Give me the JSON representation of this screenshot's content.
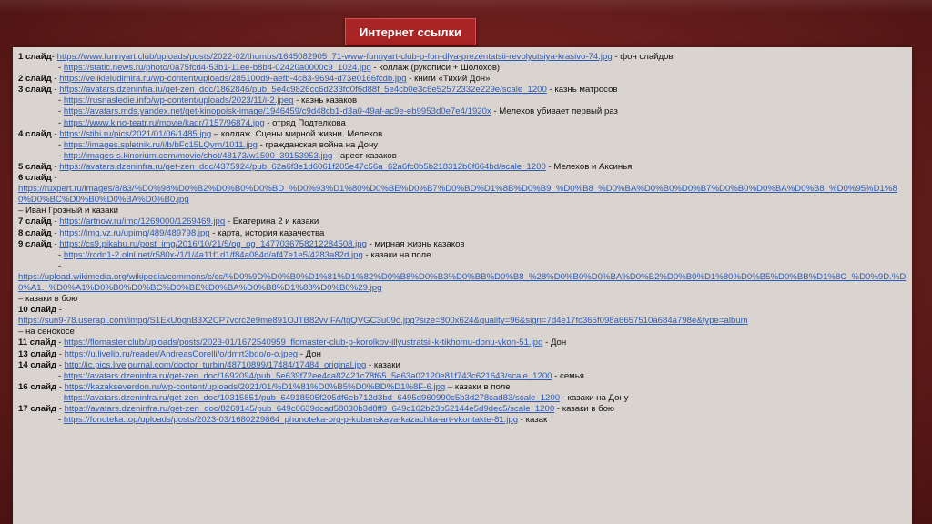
{
  "title": "Интернет ссылки",
  "lines": [
    {
      "label": "1 слайд",
      "sep": "- ",
      "url": "https://www.funnyart.club/uploads/posts/2022-02/thumbs/1645082905_71-www-funnyart-club-p-fon-dlya-prezentatsii-revolyutsiya-krasivo-74.jpg",
      "desc": " - фон слайдов"
    },
    {
      "label": "",
      "sep": "- ",
      "url": "https://static.news.ru/photo/0a75fcd4-53b1-11ee-b8b4-02420a0000c9_1024.jpg",
      "desc": " - коллаж (рукописи + Шолохов)",
      "indent": true
    },
    {
      "label": "2 слайд",
      "sep": " - ",
      "url": "https://velikieludimira.ru/wp-content/uploads/285100d9-aefb-4c83-9694-d73e0166fcdb.jpg",
      "desc": " - книги «Тихий Дон»"
    },
    {
      "label": "3 слайд",
      "sep": " - ",
      "url": "https://avatars.dzeninfra.ru/get-zen_doc/1862846/pub_5e4c9826cc6d233fd0f6d88f_5e4cb0e3c6e52572332e229e/scale_1200",
      "desc": " - казнь матросов"
    },
    {
      "label": "",
      "sep": "- ",
      "url": "https://rusnasledie.info/wp-content/uploads/2023/11/i-2.jpeg",
      "desc": " - казнь казаков",
      "indent": true
    },
    {
      "label": "",
      "sep": "- ",
      "url": "https://avatars.mds.yandex.net/get-kinopoisk-image/1946459/c9d48cb1-d3a0-49af-ac9e-eb9953d0e7e4/1920x",
      "desc": " - Мелехов убивает первый раз",
      "indent": true
    },
    {
      "label": "",
      "sep": "- ",
      "url": "https://www.kino-teatr.ru/movie/kadr/7157/96874.jpg",
      "desc": " - отряд Подтелкова",
      "indent": true
    },
    {
      "label": "4 слайд",
      "sep": " - ",
      "url": "https://stihi.ru/pics/2021/01/06/1485.jpg",
      "desc": " – коллаж. Сцены мирной жизни. Мелехов"
    },
    {
      "label": "",
      "sep": "- ",
      "url": "https://images.spletnik.ru/i/b/bFc15LQyrn/1011.jpg",
      "desc": " - гражданская война на Дону",
      "indent": true
    },
    {
      "label": "",
      "sep": "- ",
      "url": "http://images-s.kinorium.com/movie/shot/48173/w1500_39153953.jpg",
      "desc": " - арест казаков",
      "indent": true
    },
    {
      "label": "5 слайд",
      "sep": " - ",
      "url": "https://avatars.dzeninfra.ru/get-zen_doc/4375924/pub_62a6f3e1d6061f205e47c56a_62a6fc0b5b218312b6f664bd/scale_1200",
      "desc": " - Мелехов и Аксинья"
    },
    {
      "label": "6 слайд",
      "sep": " -",
      "url": "",
      "desc": ""
    },
    {
      "label": "",
      "sep": "",
      "url": "https://ruxpert.ru/images/8/83/%D0%98%D0%B2%D0%B0%D0%BD_%D0%93%D1%80%D0%BE%D0%B7%D0%BD%D1%8B%D0%B9_%D0%B8_%D0%BA%D0%B0%D0%B7%D0%B0%D0%BA%D0%B8_%D0%95%D1%80%D0%BC%D0%B0%D0%BA%D0%B0.jpg",
      "desc": "",
      "wrap": true
    },
    {
      "label": "",
      "sep": "",
      "url": "",
      "desc": " – Иван Грозный и казаки"
    },
    {
      "label": "7 слайд",
      "sep": " - ",
      "url": "https://artnow.ru/img/1269000/1269469.jpg",
      "desc": " - Екатерина 2 и казаки"
    },
    {
      "label": "8 слайд",
      "sep": " - ",
      "url": "https://img.vz.ru/upimg/489/489798.jpg",
      "desc": " - карта, история казачества"
    },
    {
      "label": "9 слайд",
      "sep": " - ",
      "url": "https://cs9.pikabu.ru/post_img/2016/10/21/5/og_og_1477036758212284508.jpg",
      "desc": " - мирная жизнь казаков"
    },
    {
      "label": "",
      "sep": "- ",
      "url": "https://rcdn1-2.olnl.net/r580x-/1/1/4a11f1d1/f84a084d/af47e1e5/4283a82d.jpg",
      "desc": " - казаки на поле",
      "indent": true
    },
    {
      "label": "",
      "sep": "-",
      "url": "",
      "desc": "",
      "indent": true
    },
    {
      "label": "",
      "sep": "",
      "url": "https://upload.wikimedia.org/wikipedia/commons/c/cc/%D0%9D%D0%B0%D1%81%D1%82%D0%B8%D0%B3%D0%BB%D0%B8_%28%D0%B0%D0%BA%D0%B2%D0%B0%D1%80%D0%B5%D0%BB%D1%8C_%D0%9D.%D0%A1._%D0%A1%D0%B0%D0%BC%D0%BE%D0%BA%D0%B8%D1%88%D0%B0%29.jpg",
      "desc": "",
      "wrap": true
    },
    {
      "label": "",
      "sep": "",
      "url": "",
      "desc": " – казаки в бою"
    },
    {
      "label": "10 слайд",
      "sep": " -",
      "url": "",
      "desc": ""
    },
    {
      "label": "",
      "sep": "",
      "url": "https://sun9-78.userapi.com/impg/S1EkUognB3X2CP7vcrc2e9me891OJTB82vvIFA/tgQVGC3u09o.jpg?size=800x624&quality=96&sign=7d4e17fc365f098a6657510a684a798e&type=album",
      "desc": ""
    },
    {
      "label": "",
      "sep": "",
      "url": "",
      "desc": " – на сенокосе"
    },
    {
      "label": "11 слайд",
      "sep": " - ",
      "url": "https://flomaster.club/uploads/posts/2023-01/1672540959_flomaster-club-p-korolkov-illyustratsii-k-tikhomu-donu-vkon-51.jpg",
      "desc": " - Дон"
    },
    {
      "label": "13 слайд",
      "sep": " - ",
      "url": "https://u.livelib.ru/reader/AndreasCorelli/o/dmrt3bdo/o-o.jpeg",
      "desc": " - Дон"
    },
    {
      "label": "14 слайд",
      "sep": " - ",
      "url": "http://ic.pics.livejournal.com/doctor_turbin/48710899/17484/17484_original.jpg",
      "desc": " - казаки"
    },
    {
      "label": "",
      "sep": "- ",
      "url": "https://avatars.dzeninfra.ru/get-zen_doc/1692094/pub_5e639f72ee4ca82421c78f65_5e63a02120e81f743c621643/scale_1200",
      "desc": " - семья",
      "indent": true
    },
    {
      "label": "16 слайд",
      "sep": " - ",
      "url": "https://kazakseverdon.ru/wp-content/uploads/2021/01/%D1%81%D0%B5%D0%BD%D1%8F-6.jpg",
      "desc": " – казаки в поле"
    },
    {
      "label": "",
      "sep": "- ",
      "url": "https://avatars.dzeninfra.ru/get-zen_doc/10315851/pub_64918505f205df6eb712d3bd_6495d960990c5b3d278cad83/scale_1200",
      "desc": " - казаки на Дону",
      "indent": true
    },
    {
      "label": "17 слайд",
      "sep": " - ",
      "url": "https://avatars.dzeninfra.ru/get-zen_doc/8269145/pub_649c0639dcad58030b3d8ff9_649c102b23b52144e5d9dec5/scale_1200",
      "desc": " - казаки в бою"
    },
    {
      "label": "",
      "sep": "- ",
      "url": "https://fonoteka.top/uploads/posts/2023-03/1680229864_phonoteka-org-p-kubanskaya-kazachka-art-vkontakte-81.jpg",
      "desc": " - казак",
      "indent": true
    }
  ]
}
